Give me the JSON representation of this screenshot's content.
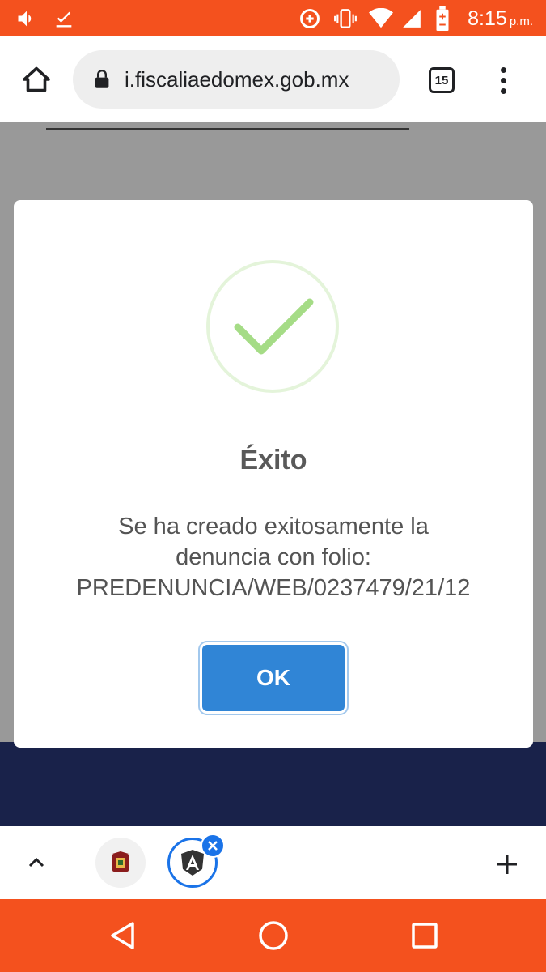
{
  "status_bar": {
    "time": "8:15",
    "ampm": "p.m.",
    "left_icons": [
      "volume-icon",
      "download-done-icon"
    ],
    "right_icons": [
      "data-saver-icon",
      "vibrate-icon",
      "wifi-icon",
      "signal-icon",
      "battery-icon"
    ],
    "color": "#f4511e"
  },
  "browser": {
    "url": "i.fiscaliaedomex.gob.mx",
    "tab_count": "15"
  },
  "modal": {
    "title": "Éxito",
    "message_line1": "Se ha creado exitosamente la",
    "message_line2": "denuncia con folio:",
    "message_line3": "PREDENUNCIA/WEB/0237479/21/12",
    "ok_label": "OK",
    "accent": "#3085d6",
    "success_color": "#a5dc86"
  },
  "tabstrip": {
    "tabs": [
      {
        "icon": "edomex-crest-icon",
        "active": false
      },
      {
        "icon": "angular-icon",
        "active": true
      }
    ]
  },
  "colors": {
    "footer_band": "#2a3a7c",
    "nav_bar": "#f4511e"
  }
}
